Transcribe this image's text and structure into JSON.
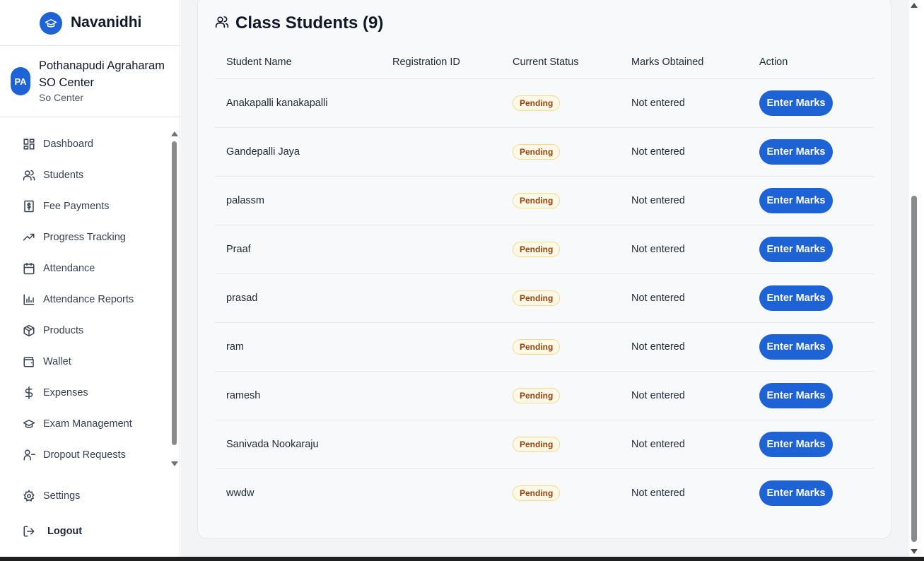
{
  "app": {
    "name": "Navanidhi"
  },
  "center": {
    "initials": "PA",
    "name": "Pothanapudi Agraharam SO Center",
    "type": "So Center"
  },
  "sidebar": {
    "items": [
      {
        "label": "Dashboard",
        "icon": "dashboard-icon"
      },
      {
        "label": "Students",
        "icon": "users-icon"
      },
      {
        "label": "Fee Payments",
        "icon": "receipt-dollar-icon"
      },
      {
        "label": "Progress Tracking",
        "icon": "trending-up-icon"
      },
      {
        "label": "Attendance",
        "icon": "calendar-icon"
      },
      {
        "label": "Attendance Reports",
        "icon": "bar-chart-icon"
      },
      {
        "label": "Products",
        "icon": "package-icon"
      },
      {
        "label": "Wallet",
        "icon": "wallet-icon"
      },
      {
        "label": "Expenses",
        "icon": "dollar-icon"
      },
      {
        "label": "Exam Management",
        "icon": "graduation-cap-icon"
      },
      {
        "label": "Dropout Requests",
        "icon": "user-minus-icon"
      }
    ],
    "settings_label": "Settings",
    "logout_label": "Logout"
  },
  "card": {
    "title": "Class Students (9)",
    "columns": [
      "Student Name",
      "Registration ID",
      "Current Status",
      "Marks Obtained",
      "Action"
    ],
    "rows": [
      {
        "name": "Anakapalli kanakapalli",
        "registration_id": "",
        "status": "Pending",
        "marks": "Not entered",
        "action": "Enter Marks"
      },
      {
        "name": "Gandepalli Jaya",
        "registration_id": "",
        "status": "Pending",
        "marks": "Not entered",
        "action": "Enter Marks"
      },
      {
        "name": "palassm",
        "registration_id": "",
        "status": "Pending",
        "marks": "Not entered",
        "action": "Enter Marks"
      },
      {
        "name": "Praaf",
        "registration_id": "",
        "status": "Pending",
        "marks": "Not entered",
        "action": "Enter Marks"
      },
      {
        "name": "prasad",
        "registration_id": "",
        "status": "Pending",
        "marks": "Not entered",
        "action": "Enter Marks"
      },
      {
        "name": "ram",
        "registration_id": "",
        "status": "Pending",
        "marks": "Not entered",
        "action": "Enter Marks"
      },
      {
        "name": "ramesh",
        "registration_id": "",
        "status": "Pending",
        "marks": "Not entered",
        "action": "Enter Marks"
      },
      {
        "name": "Sanivada Nookaraju",
        "registration_id": "",
        "status": "Pending",
        "marks": "Not entered",
        "action": "Enter Marks"
      },
      {
        "name": "wwdw",
        "registration_id": "",
        "status": "Pending",
        "marks": "Not entered",
        "action": "Enter Marks"
      }
    ]
  },
  "colors": {
    "primary": "#1e63d6",
    "pending_bg": "#fef9e7",
    "pending_text": "#92400e",
    "main_bg": "#f3f4f6"
  }
}
